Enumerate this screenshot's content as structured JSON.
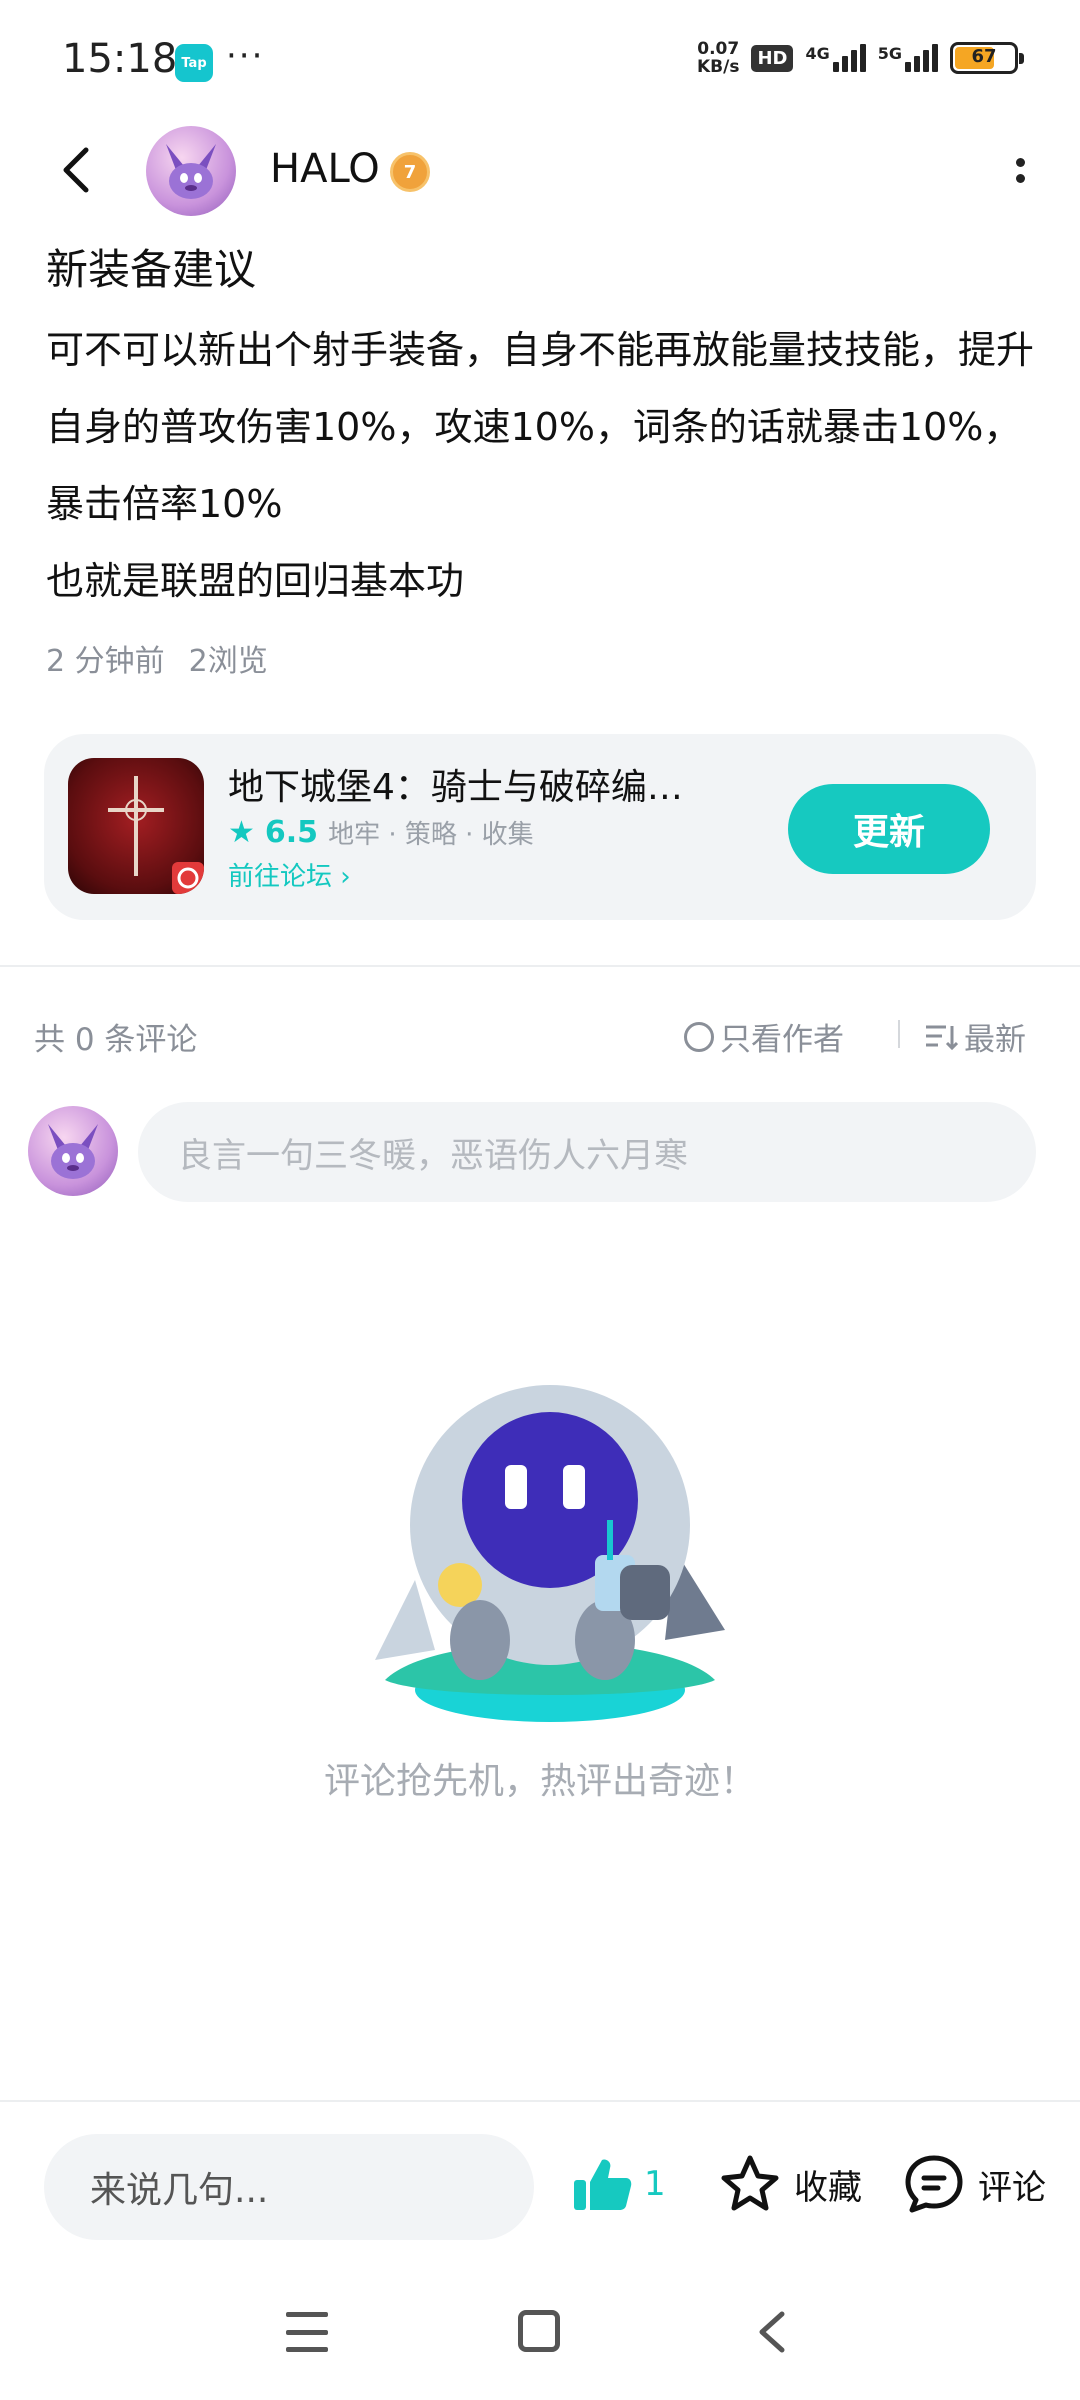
{
  "status_bar": {
    "time": "15:18",
    "tap_label": "Tap",
    "dots": "···",
    "speed_value": "0.07",
    "speed_unit": "KB/s",
    "hd_label": "HD",
    "net1_label": "4G",
    "net2_label": "5G",
    "battery": "67"
  },
  "header": {
    "user_name": "HALO",
    "level": "7"
  },
  "post": {
    "title": "新装备建议",
    "body": "可不可以新出个射手装备，自身不能再放能量技技能，提升自身的普攻伤害10%，攻速10%，词条的话就暴击10%，暴击倍率10%",
    "body_line2": "也就是联盟的回归基本功",
    "time_ago": "2 分钟前",
    "views": "2浏览"
  },
  "game_card": {
    "title": "地下城堡4：骑士与破碎编…",
    "rating": "6.5",
    "tags": "地牢 · 策略 · 收集",
    "forum_link": "前往论坛",
    "update_button": "更新"
  },
  "comments": {
    "count_text": "共 0 条评论",
    "author_only": "只看作者",
    "sort": "最新",
    "input_placeholder": "良言一句三冬暖，恶语伤人六月寒",
    "empty_text": "评论抢先机，热评出奇迹！"
  },
  "bottom_bar": {
    "say_placeholder": "来说几句...",
    "like_count": "1",
    "favorite_label": "收藏",
    "comment_label": "评论"
  },
  "colors": {
    "accent": "#16c9c0",
    "muted": "#8a8f98"
  }
}
